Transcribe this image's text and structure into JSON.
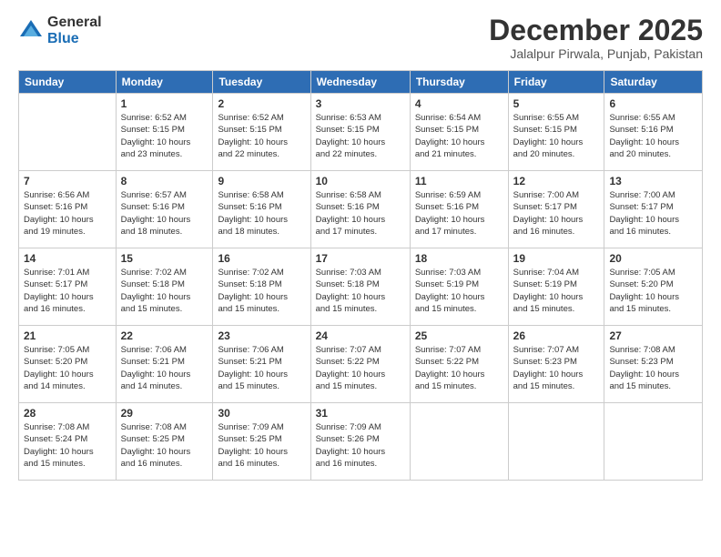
{
  "logo": {
    "general": "General",
    "blue": "Blue"
  },
  "header": {
    "month": "December 2025",
    "location": "Jalalpur Pirwala, Punjab, Pakistan"
  },
  "weekdays": [
    "Sunday",
    "Monday",
    "Tuesday",
    "Wednesday",
    "Thursday",
    "Friday",
    "Saturday"
  ],
  "weeks": [
    [
      {
        "day": "",
        "info": ""
      },
      {
        "day": "1",
        "info": "Sunrise: 6:52 AM\nSunset: 5:15 PM\nDaylight: 10 hours\nand 23 minutes."
      },
      {
        "day": "2",
        "info": "Sunrise: 6:52 AM\nSunset: 5:15 PM\nDaylight: 10 hours\nand 22 minutes."
      },
      {
        "day": "3",
        "info": "Sunrise: 6:53 AM\nSunset: 5:15 PM\nDaylight: 10 hours\nand 22 minutes."
      },
      {
        "day": "4",
        "info": "Sunrise: 6:54 AM\nSunset: 5:15 PM\nDaylight: 10 hours\nand 21 minutes."
      },
      {
        "day": "5",
        "info": "Sunrise: 6:55 AM\nSunset: 5:15 PM\nDaylight: 10 hours\nand 20 minutes."
      },
      {
        "day": "6",
        "info": "Sunrise: 6:55 AM\nSunset: 5:16 PM\nDaylight: 10 hours\nand 20 minutes."
      }
    ],
    [
      {
        "day": "7",
        "info": "Sunrise: 6:56 AM\nSunset: 5:16 PM\nDaylight: 10 hours\nand 19 minutes."
      },
      {
        "day": "8",
        "info": "Sunrise: 6:57 AM\nSunset: 5:16 PM\nDaylight: 10 hours\nand 18 minutes."
      },
      {
        "day": "9",
        "info": "Sunrise: 6:58 AM\nSunset: 5:16 PM\nDaylight: 10 hours\nand 18 minutes."
      },
      {
        "day": "10",
        "info": "Sunrise: 6:58 AM\nSunset: 5:16 PM\nDaylight: 10 hours\nand 17 minutes."
      },
      {
        "day": "11",
        "info": "Sunrise: 6:59 AM\nSunset: 5:16 PM\nDaylight: 10 hours\nand 17 minutes."
      },
      {
        "day": "12",
        "info": "Sunrise: 7:00 AM\nSunset: 5:17 PM\nDaylight: 10 hours\nand 16 minutes."
      },
      {
        "day": "13",
        "info": "Sunrise: 7:00 AM\nSunset: 5:17 PM\nDaylight: 10 hours\nand 16 minutes."
      }
    ],
    [
      {
        "day": "14",
        "info": "Sunrise: 7:01 AM\nSunset: 5:17 PM\nDaylight: 10 hours\nand 16 minutes."
      },
      {
        "day": "15",
        "info": "Sunrise: 7:02 AM\nSunset: 5:18 PM\nDaylight: 10 hours\nand 15 minutes."
      },
      {
        "day": "16",
        "info": "Sunrise: 7:02 AM\nSunset: 5:18 PM\nDaylight: 10 hours\nand 15 minutes."
      },
      {
        "day": "17",
        "info": "Sunrise: 7:03 AM\nSunset: 5:18 PM\nDaylight: 10 hours\nand 15 minutes."
      },
      {
        "day": "18",
        "info": "Sunrise: 7:03 AM\nSunset: 5:19 PM\nDaylight: 10 hours\nand 15 minutes."
      },
      {
        "day": "19",
        "info": "Sunrise: 7:04 AM\nSunset: 5:19 PM\nDaylight: 10 hours\nand 15 minutes."
      },
      {
        "day": "20",
        "info": "Sunrise: 7:05 AM\nSunset: 5:20 PM\nDaylight: 10 hours\nand 15 minutes."
      }
    ],
    [
      {
        "day": "21",
        "info": "Sunrise: 7:05 AM\nSunset: 5:20 PM\nDaylight: 10 hours\nand 14 minutes."
      },
      {
        "day": "22",
        "info": "Sunrise: 7:06 AM\nSunset: 5:21 PM\nDaylight: 10 hours\nand 14 minutes."
      },
      {
        "day": "23",
        "info": "Sunrise: 7:06 AM\nSunset: 5:21 PM\nDaylight: 10 hours\nand 15 minutes."
      },
      {
        "day": "24",
        "info": "Sunrise: 7:07 AM\nSunset: 5:22 PM\nDaylight: 10 hours\nand 15 minutes."
      },
      {
        "day": "25",
        "info": "Sunrise: 7:07 AM\nSunset: 5:22 PM\nDaylight: 10 hours\nand 15 minutes."
      },
      {
        "day": "26",
        "info": "Sunrise: 7:07 AM\nSunset: 5:23 PM\nDaylight: 10 hours\nand 15 minutes."
      },
      {
        "day": "27",
        "info": "Sunrise: 7:08 AM\nSunset: 5:23 PM\nDaylight: 10 hours\nand 15 minutes."
      }
    ],
    [
      {
        "day": "28",
        "info": "Sunrise: 7:08 AM\nSunset: 5:24 PM\nDaylight: 10 hours\nand 15 minutes."
      },
      {
        "day": "29",
        "info": "Sunrise: 7:08 AM\nSunset: 5:25 PM\nDaylight: 10 hours\nand 16 minutes."
      },
      {
        "day": "30",
        "info": "Sunrise: 7:09 AM\nSunset: 5:25 PM\nDaylight: 10 hours\nand 16 minutes."
      },
      {
        "day": "31",
        "info": "Sunrise: 7:09 AM\nSunset: 5:26 PM\nDaylight: 10 hours\nand 16 minutes."
      },
      {
        "day": "",
        "info": ""
      },
      {
        "day": "",
        "info": ""
      },
      {
        "day": "",
        "info": ""
      }
    ]
  ]
}
